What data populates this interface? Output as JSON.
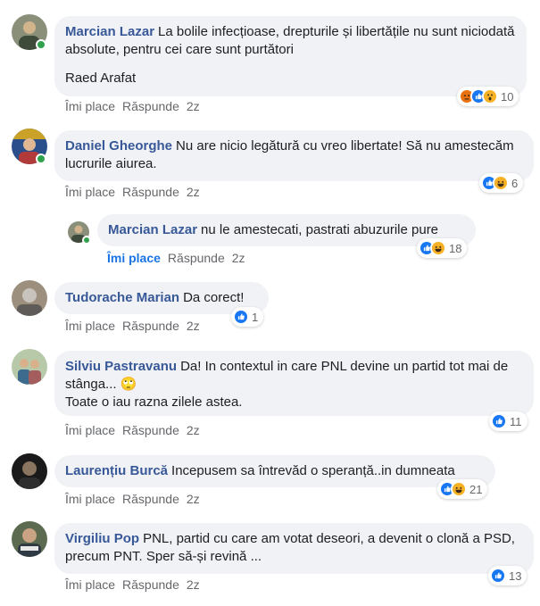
{
  "actions": {
    "like": "Îmi place",
    "reply": "Răspunde"
  },
  "comments": [
    {
      "author": "Marcian Lazar",
      "text": "La bolile infecțioase, drepturile și libertățile nu sunt niciodată absolute, pentru cei care sunt purtători",
      "extra": "Raed Arafat",
      "time": "2z",
      "reaction_count": "10",
      "reactions": [
        "angry",
        "like",
        "wow"
      ]
    },
    {
      "author": "Daniel Gheorghe",
      "text": "Nu are nicio legătură cu vreo libertate! Să nu amestecăm lucrurile aiurea.",
      "time": "2z",
      "reaction_count": "6",
      "reactions": [
        "like",
        "haha"
      ]
    },
    {
      "author": "Marcian Lazar",
      "text": "nu le amestecati, pastrati abuzurile pure",
      "time": "2z",
      "reaction_count": "18",
      "reactions": [
        "like",
        "haha"
      ]
    },
    {
      "author": "Tudorache Marian",
      "text": "Da corect!",
      "time": "2z",
      "reaction_count": "1",
      "reactions": [
        "like"
      ]
    },
    {
      "author": "Silviu Pastravanu",
      "text": "Da! In contextul in care PNL devine un partid tot mai de stânga...",
      "emoji": "🙄",
      "extra": "Toate o iau razna zilele astea.",
      "time": "2z",
      "reaction_count": "11",
      "reactions": [
        "like"
      ]
    },
    {
      "author": "Laurențiu Burcă",
      "text": "Incepusem sa întrevăd o speranță..in dumneata",
      "time": "2z",
      "reaction_count": "21",
      "reactions": [
        "like",
        "haha"
      ]
    },
    {
      "author": "Virgiliu Pop",
      "text": "PNL, partid cu care am votat deseori, a devenit o clonă a PSD, precum PNT. Sper să-și revină ...",
      "time": "2z",
      "reaction_count": "13",
      "reactions": [
        "like"
      ]
    }
  ],
  "colors": {
    "author": "#385898",
    "bubble": "#f0f2f5",
    "like_blue": "#1877f2",
    "haha_yellow": "#f7b125",
    "angry_red": "#e9710f",
    "online_green": "#31a24c",
    "active_like": "#1b74e4"
  }
}
